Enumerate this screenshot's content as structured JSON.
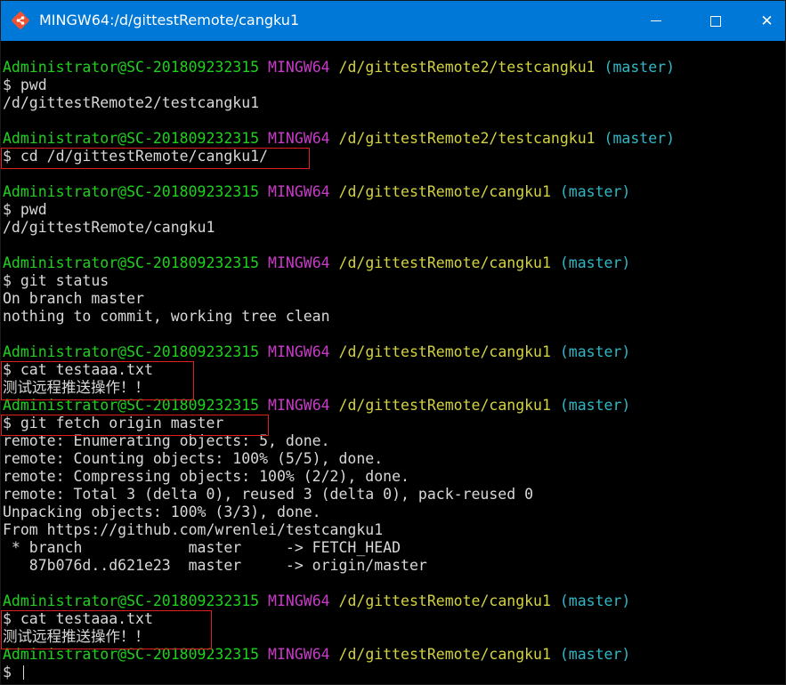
{
  "window": {
    "title": "MINGW64:/d/gittestRemote/cangku1",
    "app_icon": "git-bash-icon",
    "controls": [
      "minimize-icon",
      "maximize-icon",
      "close-icon"
    ],
    "close_glyph": "✕"
  },
  "colors": {
    "titlebar": "#0078d7",
    "user": "#1fd11f",
    "system": "#c83bc8",
    "path": "#d3d33f",
    "branch": "#2fb7c4",
    "highlight": "#e02020"
  },
  "prompt": {
    "user": "Administrator@SC-201809232315",
    "system": "MINGW64",
    "branch": "(master)",
    "symbol": "$ "
  },
  "blocks": [
    {
      "path": "/d/gittestRemote2/testcangku1",
      "command": "pwd",
      "output": [
        "/d/gittestRemote2/testcangku1"
      ]
    },
    {
      "path": "/d/gittestRemote2/testcangku1",
      "command": "cd /d/gittestRemote/cangku1/",
      "output": []
    },
    {
      "path": "/d/gittestRemote/cangku1",
      "command": "pwd",
      "output": [
        "/d/gittestRemote/cangku1"
      ]
    },
    {
      "path": "/d/gittestRemote/cangku1",
      "command": "git status",
      "output": [
        "On branch master",
        "nothing to commit, working tree clean"
      ]
    },
    {
      "path": "/d/gittestRemote/cangku1",
      "command": "cat testaaa.txt",
      "output": [
        "测试远程推送操作！！"
      ]
    },
    {
      "path": "/d/gittestRemote/cangku1",
      "command": "git fetch origin master",
      "output": [
        "remote: Enumerating objects: 5, done.",
        "remote: Counting objects: 100% (5/5), done.",
        "remote: Compressing objects: 100% (2/2), done.",
        "remote: Total 3 (delta 0), reused 3 (delta 0), pack-reused 0",
        "Unpacking objects: 100% (3/3), done.",
        "From https://github.com/wrenlei/testcangku1",
        " * branch            master     -> FETCH_HEAD",
        "   87b076d..d621e23  master     -> origin/master"
      ]
    },
    {
      "path": "/d/gittestRemote/cangku1",
      "command": "cat testaaa.txt",
      "output": [
        "测试远程推送操作！！"
      ]
    },
    {
      "path": "/d/gittestRemote/cangku1",
      "command": "",
      "output": []
    }
  ]
}
